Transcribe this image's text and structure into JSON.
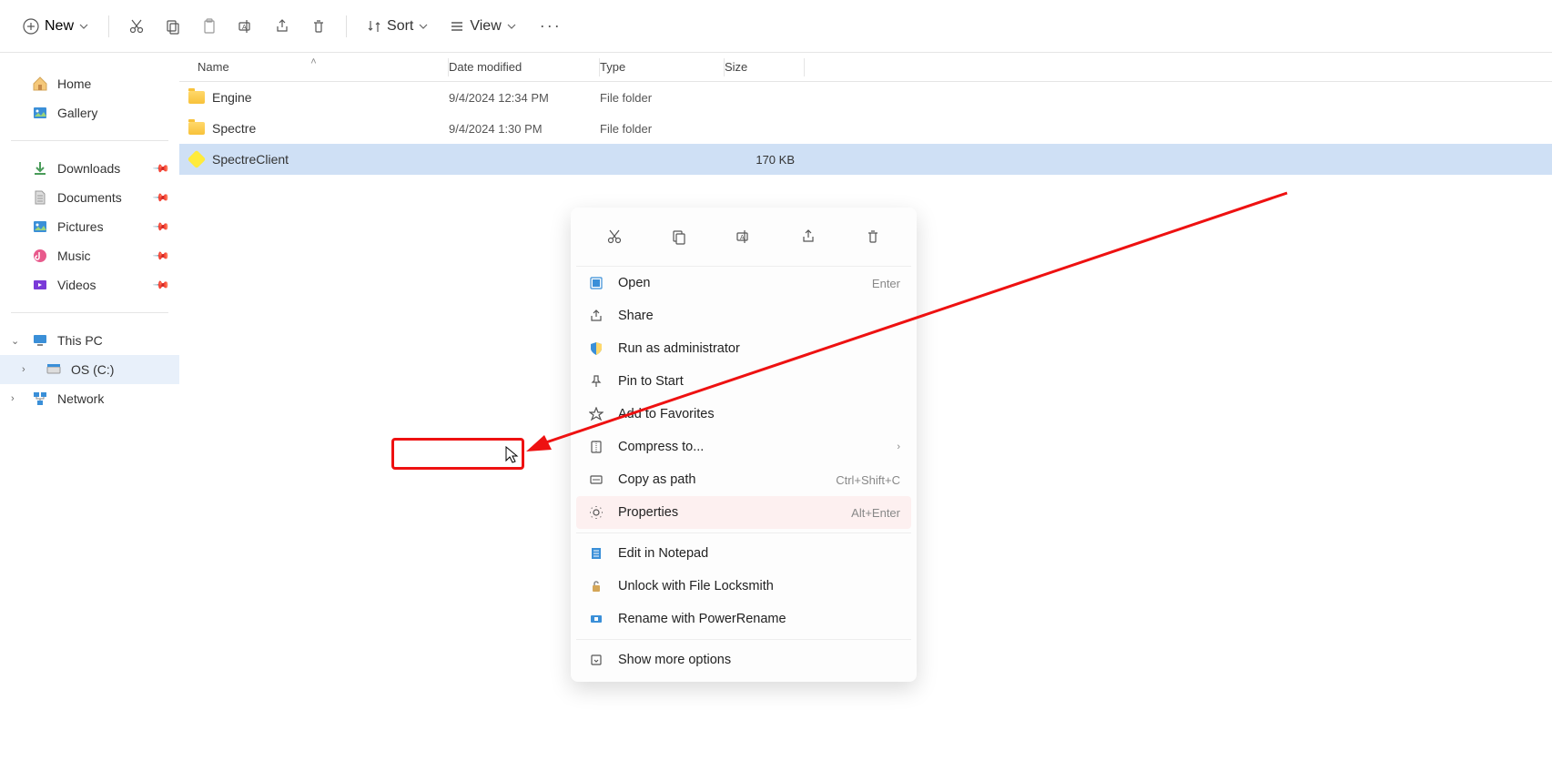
{
  "toolbar": {
    "new_label": "New",
    "sort_label": "Sort",
    "view_label": "View"
  },
  "sidebar": {
    "home": "Home",
    "gallery": "Gallery",
    "downloads": "Downloads",
    "documents": "Documents",
    "pictures": "Pictures",
    "music": "Music",
    "videos": "Videos",
    "this_pc": "This PC",
    "os_c": "OS (C:)",
    "network": "Network"
  },
  "columns": {
    "name": "Name",
    "date": "Date modified",
    "type": "Type",
    "size": "Size"
  },
  "files": [
    {
      "name": "Engine",
      "date": "9/4/2024 12:34 PM",
      "type": "File folder",
      "size": "",
      "kind": "folder"
    },
    {
      "name": "Spectre",
      "date": "9/4/2024 1:30 PM",
      "type": "File folder",
      "size": "",
      "kind": "folder"
    },
    {
      "name": "SpectreClient",
      "date": "",
      "type": "",
      "size": "170 KB",
      "kind": "app",
      "selected": true
    }
  ],
  "context_menu": {
    "open": "Open",
    "open_key": "Enter",
    "share": "Share",
    "run_admin": "Run as administrator",
    "pin_start": "Pin to Start",
    "add_fav": "Add to Favorites",
    "compress": "Compress to...",
    "copy_path": "Copy as path",
    "copy_path_key": "Ctrl+Shift+C",
    "properties": "Properties",
    "properties_key": "Alt+Enter",
    "edit_notepad": "Edit in Notepad",
    "unlock": "Unlock with File Locksmith",
    "rename": "Rename with PowerRename",
    "show_more": "Show more options"
  }
}
